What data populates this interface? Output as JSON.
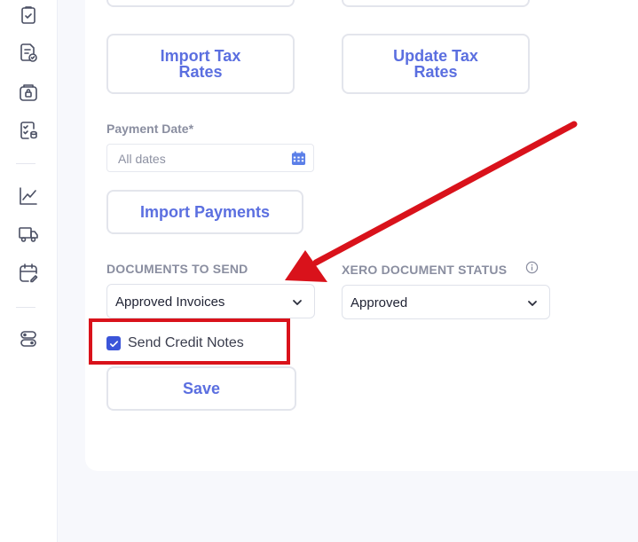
{
  "sidebar": {
    "items": [
      {
        "icon": "clipboard-check-icon"
      },
      {
        "icon": "document-check-icon"
      },
      {
        "icon": "wallet-lock-icon"
      },
      {
        "icon": "checklist-database-icon"
      },
      {
        "icon": "line-chart-icon"
      },
      {
        "icon": "truck-icon"
      },
      {
        "icon": "calendar-edit-icon"
      },
      {
        "icon": "server-toggle-icon"
      }
    ]
  },
  "main": {
    "import_tax_rates": {
      "line1": "Import Tax",
      "line2": "Rates"
    },
    "update_tax_rates": {
      "line1": "Update Tax",
      "line2": "Rates"
    },
    "payment_date": {
      "label": "Payment Date*",
      "placeholder": "All dates"
    },
    "import_payments": {
      "label": "Import Payments"
    },
    "documents_to_send": {
      "label": "DOCUMENTS TO SEND",
      "selected": "Approved Invoices"
    },
    "xero_status": {
      "label": "XERO DOCUMENT STATUS",
      "selected": "Approved"
    },
    "send_credit_notes": {
      "label": "Send Credit Notes",
      "checked": true
    },
    "save": {
      "label": "Save"
    }
  },
  "colors": {
    "accent": "#5b6fe0",
    "checkbox": "#3b55d9",
    "annotation": "#d9121b"
  }
}
